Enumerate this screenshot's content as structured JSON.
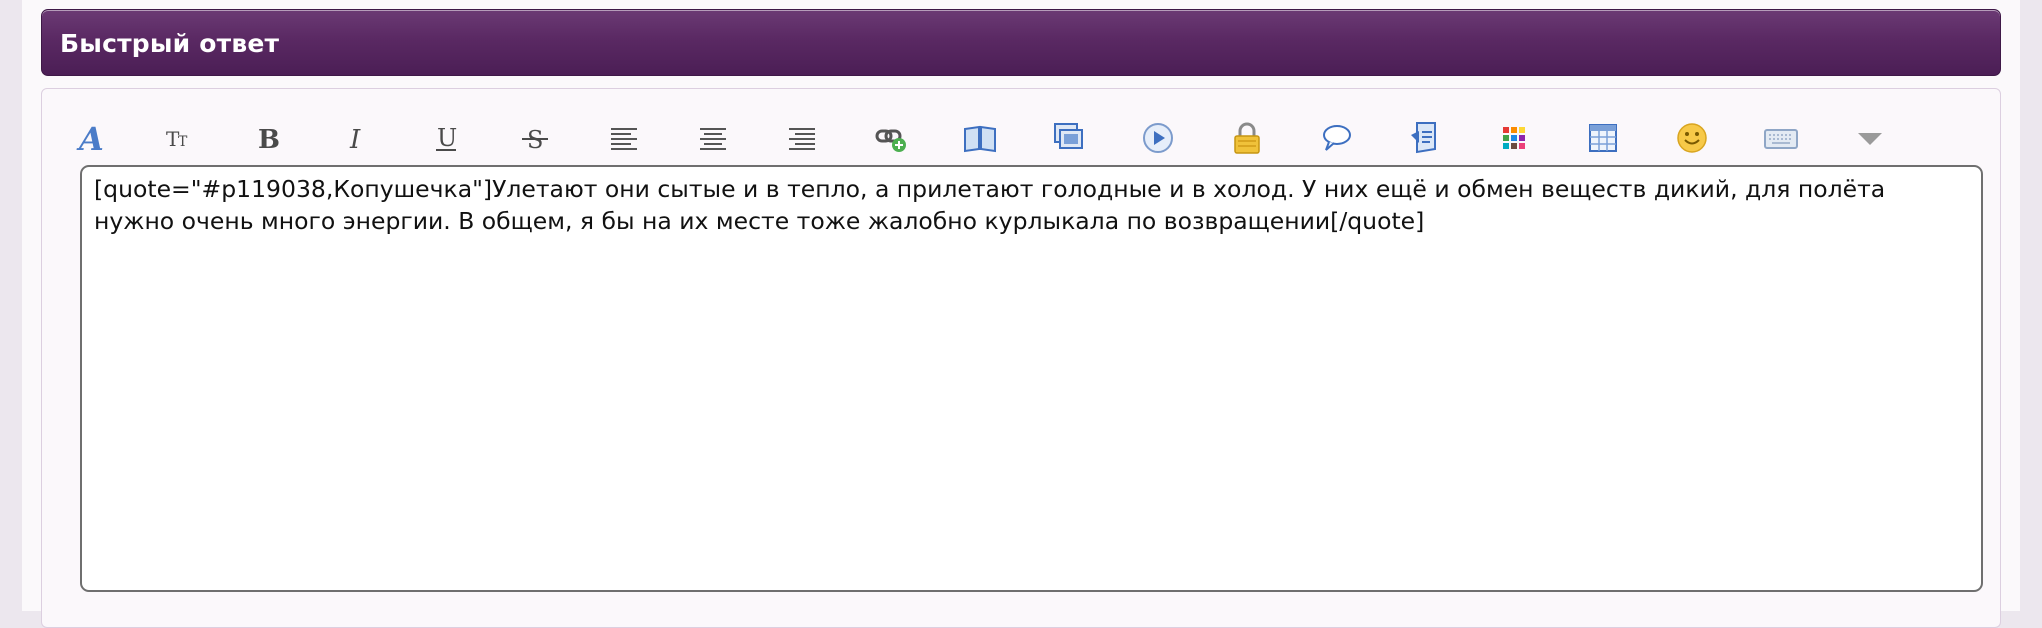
{
  "header": {
    "title": "Быстрый ответ"
  },
  "toolbar": {
    "items": [
      {
        "name": "font-color",
        "icon": "font-color-icon"
      },
      {
        "name": "font-size",
        "icon": "font-size-icon"
      },
      {
        "name": "bold",
        "icon": "bold-icon"
      },
      {
        "name": "italic",
        "icon": "italic-icon"
      },
      {
        "name": "underline",
        "icon": "underline-icon"
      },
      {
        "name": "strikethrough",
        "icon": "strikethrough-icon"
      },
      {
        "name": "align-left",
        "icon": "align-left-icon"
      },
      {
        "name": "align-center",
        "icon": "align-center-icon"
      },
      {
        "name": "align-right",
        "icon": "align-right-icon"
      },
      {
        "name": "link",
        "icon": "link-icon"
      },
      {
        "name": "book",
        "icon": "book-icon"
      },
      {
        "name": "image",
        "icon": "image-icon"
      },
      {
        "name": "video",
        "icon": "play-icon"
      },
      {
        "name": "hide",
        "icon": "lock-icon"
      },
      {
        "name": "quote",
        "icon": "speech-bubble-icon"
      },
      {
        "name": "code",
        "icon": "code-icon"
      },
      {
        "name": "color-palette",
        "icon": "color-grid-icon"
      },
      {
        "name": "table",
        "icon": "table-icon"
      },
      {
        "name": "smiley",
        "icon": "smiley-icon"
      },
      {
        "name": "keyboard",
        "icon": "keyboard-icon"
      },
      {
        "name": "more",
        "icon": "triangle-down-icon"
      }
    ]
  },
  "editor": {
    "text": "[quote=\"#p119038,Копушечка\"]Улетают они сытые и в тепло, а прилетают голодные и в холод. У них ещё и обмен веществ дикий, для полёта нужно очень много энергии. В общем, я бы на их месте тоже жалобно курлыкала по возвращении[/quote]"
  },
  "colors": {
    "header_bg": "#5a2963",
    "header_text": "#ffffff",
    "page_bg": "#fbf9fb",
    "accent_blue": "#3d6fc0"
  }
}
